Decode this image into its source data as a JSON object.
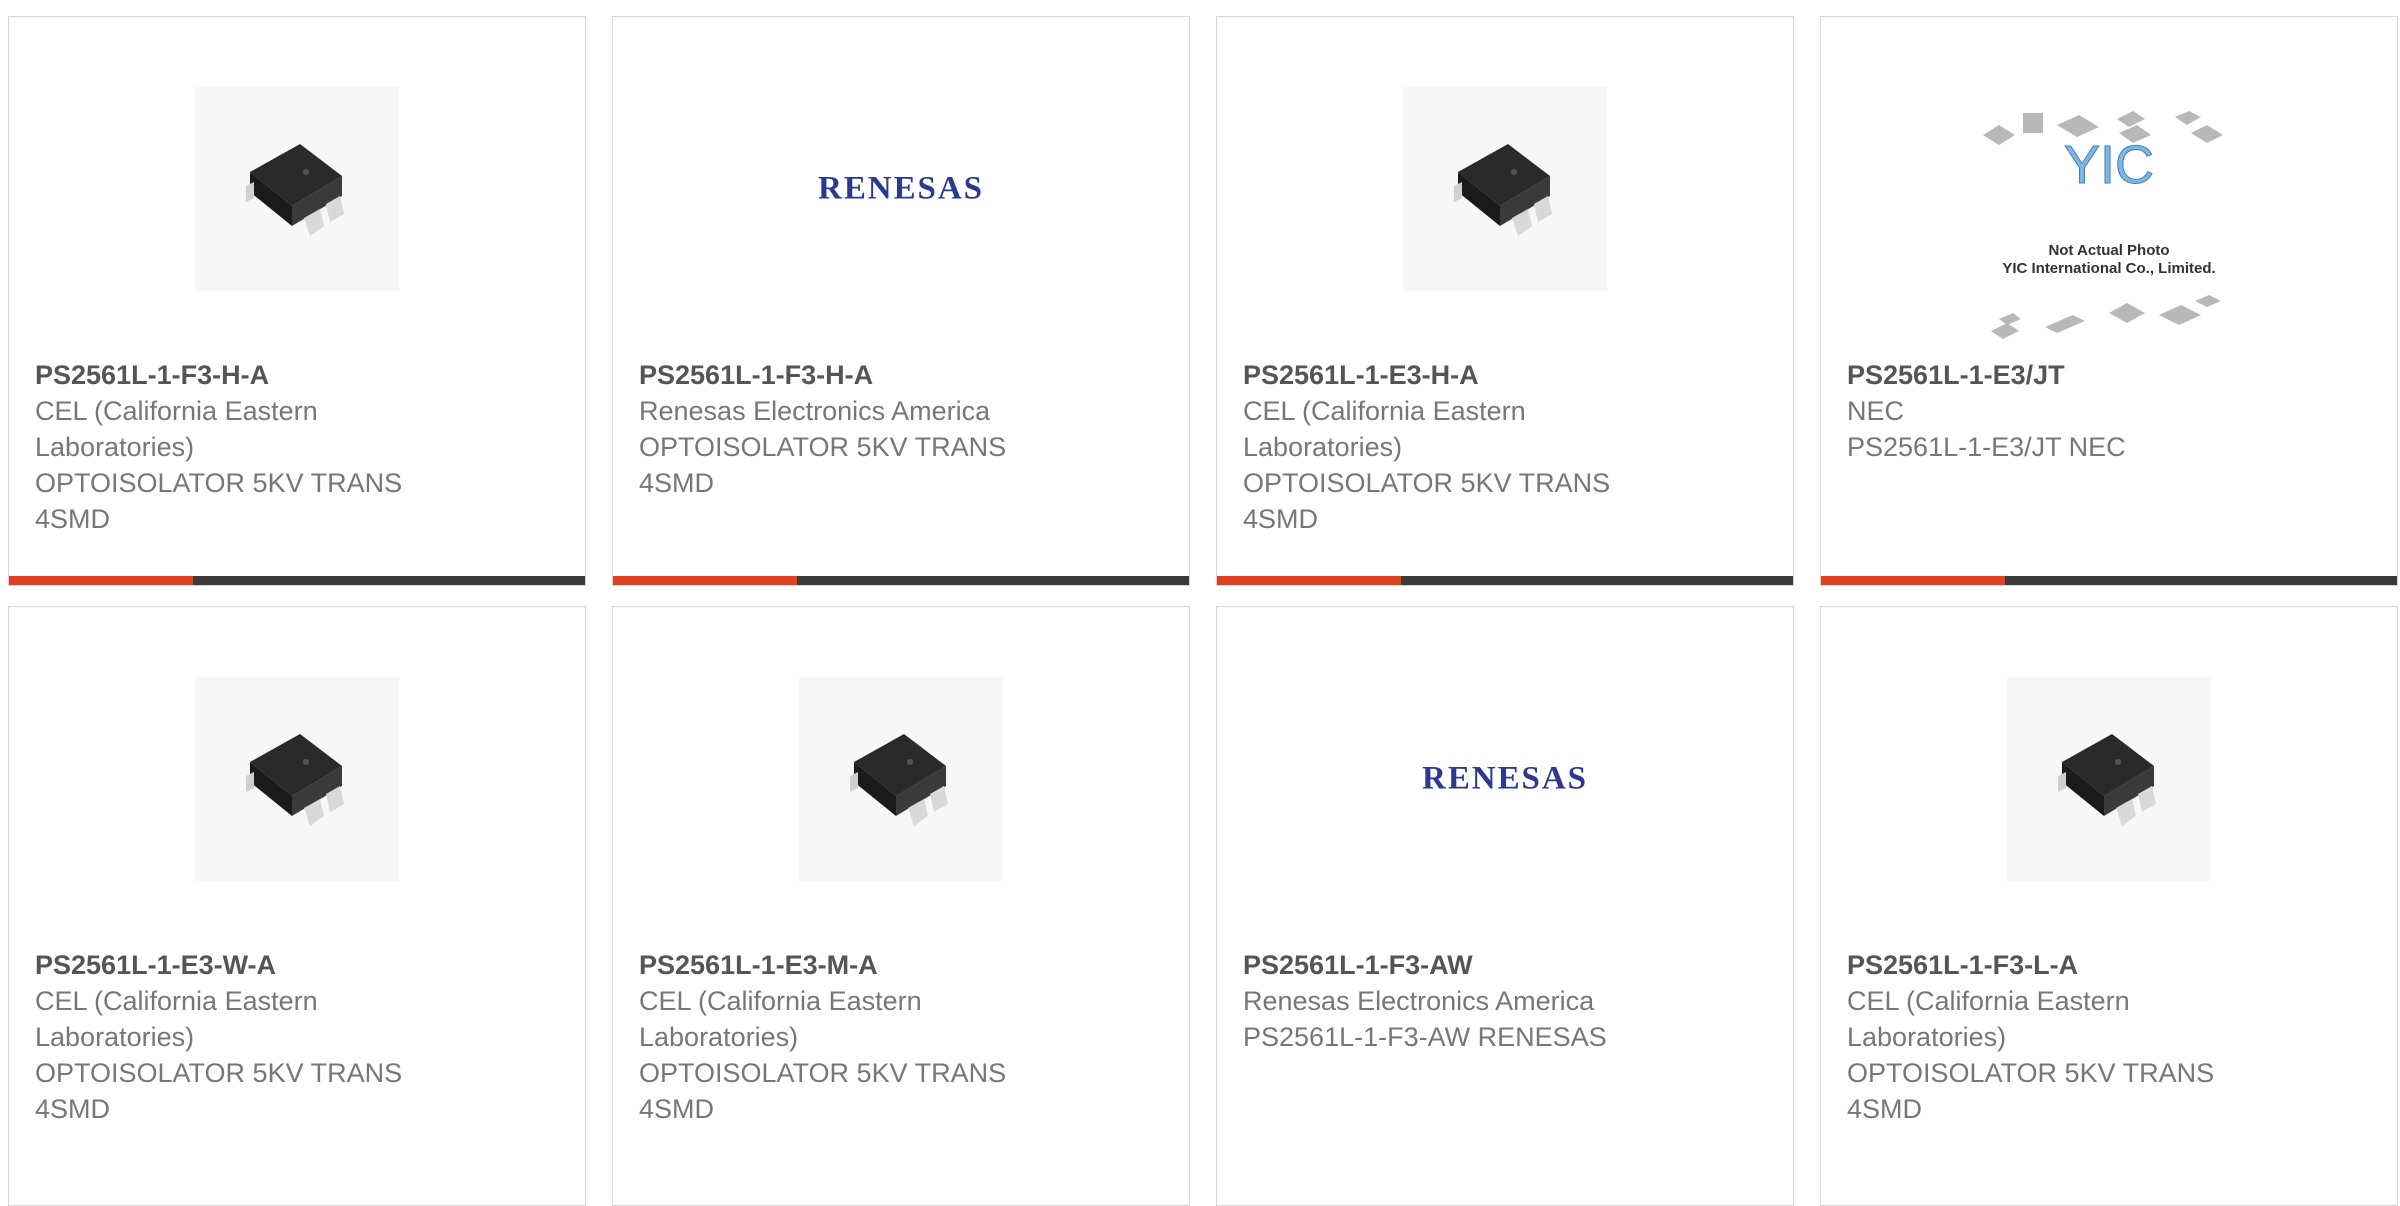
{
  "accent_color": "#e2401c",
  "bar_color": "#3b3b3b",
  "products": [
    {
      "image": "optoisolator-chip-photo",
      "part_number": "PS2561L-1-F3-H-A",
      "manufacturer_lines": [
        "CEL (California Eastern",
        "Laboratories)"
      ],
      "description_lines": [
        "OPTOISOLATOR 5KV TRANS",
        "4SMD"
      ]
    },
    {
      "image": "renesas-logo",
      "logo_text": "RENESAS",
      "part_number": "PS2561L-1-F3-H-A",
      "manufacturer_lines": [
        "Renesas Electronics America"
      ],
      "description_lines": [
        "OPTOISOLATOR 5KV TRANS",
        "4SMD"
      ]
    },
    {
      "image": "optoisolator-chip-photo",
      "part_number": "PS2561L-1-E3-H-A",
      "manufacturer_lines": [
        "CEL (California Eastern",
        "Laboratories)"
      ],
      "description_lines": [
        "OPTOISOLATOR 5KV TRANS",
        "4SMD"
      ]
    },
    {
      "image": "yic-placeholder",
      "placeholder_logo": "YIC",
      "placeholder_line1": "Not Actual Photo",
      "placeholder_line2": "YIC International Co., Limited.",
      "part_number": "PS2561L-1-E3/JT",
      "manufacturer_lines": [
        "NEC"
      ],
      "description_lines": [
        "PS2561L-1-E3/JT NEC"
      ]
    },
    {
      "image": "optoisolator-chip-photo",
      "part_number": "PS2561L-1-E3-W-A",
      "manufacturer_lines": [
        "CEL (California Eastern",
        "Laboratories)"
      ],
      "description_lines": [
        "OPTOISOLATOR 5KV TRANS",
        "4SMD"
      ]
    },
    {
      "image": "optoisolator-chip-photo",
      "part_number": "PS2561L-1-E3-M-A",
      "manufacturer_lines": [
        "CEL (California Eastern",
        "Laboratories)"
      ],
      "description_lines": [
        "OPTOISOLATOR 5KV TRANS",
        "4SMD"
      ]
    },
    {
      "image": "renesas-logo",
      "logo_text": "RENESAS",
      "part_number": "PS2561L-1-F3-AW",
      "manufacturer_lines": [
        "Renesas Electronics America"
      ],
      "description_lines": [
        "PS2561L-1-F3-AW RENESAS"
      ]
    },
    {
      "image": "optoisolator-chip-photo",
      "part_number": "PS2561L-1-F3-L-A",
      "manufacturer_lines": [
        "CEL (California Eastern",
        "Laboratories)"
      ],
      "description_lines": [
        "OPTOISOLATOR 5KV TRANS",
        "4SMD"
      ]
    }
  ]
}
